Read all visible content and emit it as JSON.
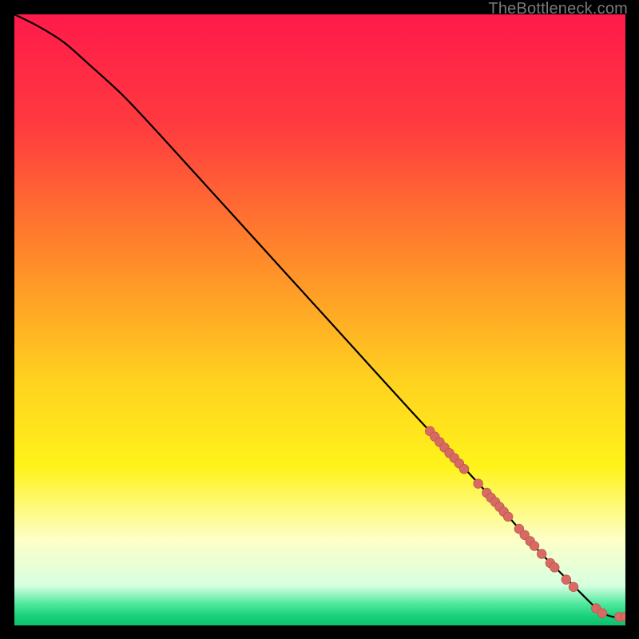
{
  "watermark": "TheBottleneck.com",
  "colors": {
    "gradient_stops": [
      {
        "offset": 0.0,
        "color": "#ff1a4b"
      },
      {
        "offset": 0.18,
        "color": "#ff3a3f"
      },
      {
        "offset": 0.4,
        "color": "#ff8a2a"
      },
      {
        "offset": 0.6,
        "color": "#ffd21f"
      },
      {
        "offset": 0.74,
        "color": "#fff31a"
      },
      {
        "offset": 0.86,
        "color": "#fdffc8"
      },
      {
        "offset": 0.935,
        "color": "#d7ffe0"
      },
      {
        "offset": 0.965,
        "color": "#4fe89d"
      },
      {
        "offset": 0.985,
        "color": "#17d17a"
      },
      {
        "offset": 1.0,
        "color": "#0fbf6e"
      }
    ],
    "curve": "#000000",
    "marker_fill": "#d96a63",
    "marker_stroke": "#b9564f"
  },
  "chart_data": {
    "type": "line",
    "title": "",
    "xlabel": "",
    "ylabel": "",
    "xlim": [
      0,
      100
    ],
    "ylim": [
      0,
      100
    ],
    "series": [
      {
        "name": "curve",
        "x": [
          0,
          4,
          8,
          12,
          18,
          25,
          35,
          45,
          55,
          65,
          72,
          78,
          82,
          86,
          89,
          92,
          94,
          96,
          98,
          100
        ],
        "y": [
          100,
          98,
          95.5,
          92,
          86.5,
          79,
          68,
          57,
          46,
          35,
          27.5,
          21,
          16.5,
          12,
          9,
          6,
          4,
          2.2,
          1.4,
          1.4
        ]
      }
    ],
    "markers": [
      {
        "x": 68.0,
        "y": 31.8,
        "r": 5.8
      },
      {
        "x": 68.8,
        "y": 30.9,
        "r": 5.8
      },
      {
        "x": 69.6,
        "y": 30.0,
        "r": 5.8
      },
      {
        "x": 70.4,
        "y": 29.1,
        "r": 5.8
      },
      {
        "x": 71.2,
        "y": 28.2,
        "r": 5.8
      },
      {
        "x": 72.0,
        "y": 27.4,
        "r": 5.8
      },
      {
        "x": 72.8,
        "y": 26.5,
        "r": 5.8
      },
      {
        "x": 73.6,
        "y": 25.6,
        "r": 5.8
      },
      {
        "x": 75.9,
        "y": 23.2,
        "r": 5.8
      },
      {
        "x": 77.3,
        "y": 21.7,
        "r": 5.8
      },
      {
        "x": 78.0,
        "y": 20.9,
        "r": 5.8
      },
      {
        "x": 78.7,
        "y": 20.2,
        "r": 5.8
      },
      {
        "x": 79.4,
        "y": 19.4,
        "r": 5.8
      },
      {
        "x": 80.1,
        "y": 18.6,
        "r": 5.8
      },
      {
        "x": 80.8,
        "y": 17.8,
        "r": 5.8
      },
      {
        "x": 82.6,
        "y": 15.8,
        "r": 5.8
      },
      {
        "x": 83.5,
        "y": 14.8,
        "r": 5.8
      },
      {
        "x": 84.4,
        "y": 13.8,
        "r": 5.8
      },
      {
        "x": 85.1,
        "y": 13.0,
        "r": 5.8
      },
      {
        "x": 86.3,
        "y": 11.7,
        "r": 5.8
      },
      {
        "x": 87.7,
        "y": 10.2,
        "r": 5.8
      },
      {
        "x": 88.4,
        "y": 9.5,
        "r": 5.8
      },
      {
        "x": 90.3,
        "y": 7.5,
        "r": 5.8
      },
      {
        "x": 91.5,
        "y": 6.3,
        "r": 5.8
      },
      {
        "x": 95.2,
        "y": 2.8,
        "r": 5.8
      },
      {
        "x": 96.2,
        "y": 2.0,
        "r": 5.8
      },
      {
        "x": 99.0,
        "y": 1.4,
        "r": 5.8
      },
      {
        "x": 100.0,
        "y": 1.4,
        "r": 5.8
      }
    ]
  }
}
